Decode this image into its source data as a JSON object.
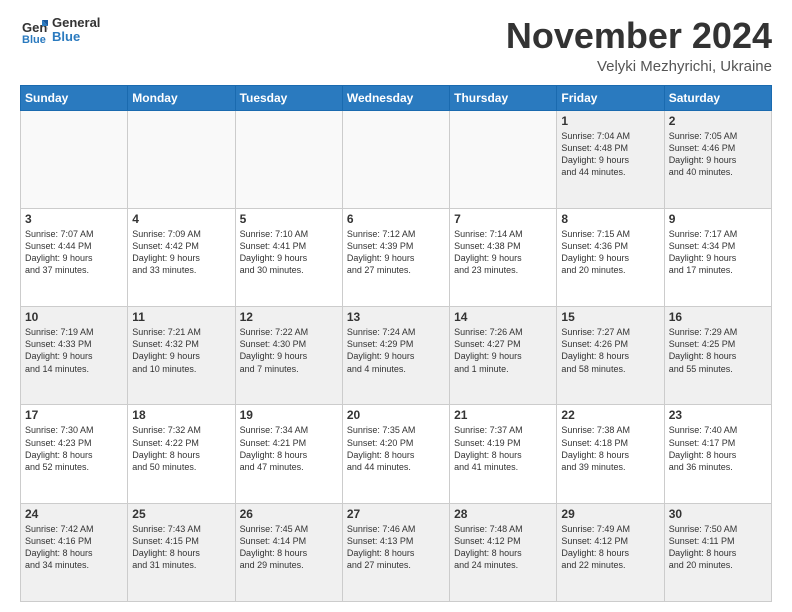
{
  "logo": {
    "line1": "General",
    "line2": "Blue"
  },
  "title": "November 2024",
  "location": "Velyki Mezhyrichi, Ukraine",
  "weekdays": [
    "Sunday",
    "Monday",
    "Tuesday",
    "Wednesday",
    "Thursday",
    "Friday",
    "Saturday"
  ],
  "weeks": [
    [
      {
        "day": "",
        "info": ""
      },
      {
        "day": "",
        "info": ""
      },
      {
        "day": "",
        "info": ""
      },
      {
        "day": "",
        "info": ""
      },
      {
        "day": "",
        "info": ""
      },
      {
        "day": "1",
        "info": "Sunrise: 7:04 AM\nSunset: 4:48 PM\nDaylight: 9 hours\nand 44 minutes."
      },
      {
        "day": "2",
        "info": "Sunrise: 7:05 AM\nSunset: 4:46 PM\nDaylight: 9 hours\nand 40 minutes."
      }
    ],
    [
      {
        "day": "3",
        "info": "Sunrise: 7:07 AM\nSunset: 4:44 PM\nDaylight: 9 hours\nand 37 minutes."
      },
      {
        "day": "4",
        "info": "Sunrise: 7:09 AM\nSunset: 4:42 PM\nDaylight: 9 hours\nand 33 minutes."
      },
      {
        "day": "5",
        "info": "Sunrise: 7:10 AM\nSunset: 4:41 PM\nDaylight: 9 hours\nand 30 minutes."
      },
      {
        "day": "6",
        "info": "Sunrise: 7:12 AM\nSunset: 4:39 PM\nDaylight: 9 hours\nand 27 minutes."
      },
      {
        "day": "7",
        "info": "Sunrise: 7:14 AM\nSunset: 4:38 PM\nDaylight: 9 hours\nand 23 minutes."
      },
      {
        "day": "8",
        "info": "Sunrise: 7:15 AM\nSunset: 4:36 PM\nDaylight: 9 hours\nand 20 minutes."
      },
      {
        "day": "9",
        "info": "Sunrise: 7:17 AM\nSunset: 4:34 PM\nDaylight: 9 hours\nand 17 minutes."
      }
    ],
    [
      {
        "day": "10",
        "info": "Sunrise: 7:19 AM\nSunset: 4:33 PM\nDaylight: 9 hours\nand 14 minutes."
      },
      {
        "day": "11",
        "info": "Sunrise: 7:21 AM\nSunset: 4:32 PM\nDaylight: 9 hours\nand 10 minutes."
      },
      {
        "day": "12",
        "info": "Sunrise: 7:22 AM\nSunset: 4:30 PM\nDaylight: 9 hours\nand 7 minutes."
      },
      {
        "day": "13",
        "info": "Sunrise: 7:24 AM\nSunset: 4:29 PM\nDaylight: 9 hours\nand 4 minutes."
      },
      {
        "day": "14",
        "info": "Sunrise: 7:26 AM\nSunset: 4:27 PM\nDaylight: 9 hours\nand 1 minute."
      },
      {
        "day": "15",
        "info": "Sunrise: 7:27 AM\nSunset: 4:26 PM\nDaylight: 8 hours\nand 58 minutes."
      },
      {
        "day": "16",
        "info": "Sunrise: 7:29 AM\nSunset: 4:25 PM\nDaylight: 8 hours\nand 55 minutes."
      }
    ],
    [
      {
        "day": "17",
        "info": "Sunrise: 7:30 AM\nSunset: 4:23 PM\nDaylight: 8 hours\nand 52 minutes."
      },
      {
        "day": "18",
        "info": "Sunrise: 7:32 AM\nSunset: 4:22 PM\nDaylight: 8 hours\nand 50 minutes."
      },
      {
        "day": "19",
        "info": "Sunrise: 7:34 AM\nSunset: 4:21 PM\nDaylight: 8 hours\nand 47 minutes."
      },
      {
        "day": "20",
        "info": "Sunrise: 7:35 AM\nSunset: 4:20 PM\nDaylight: 8 hours\nand 44 minutes."
      },
      {
        "day": "21",
        "info": "Sunrise: 7:37 AM\nSunset: 4:19 PM\nDaylight: 8 hours\nand 41 minutes."
      },
      {
        "day": "22",
        "info": "Sunrise: 7:38 AM\nSunset: 4:18 PM\nDaylight: 8 hours\nand 39 minutes."
      },
      {
        "day": "23",
        "info": "Sunrise: 7:40 AM\nSunset: 4:17 PM\nDaylight: 8 hours\nand 36 minutes."
      }
    ],
    [
      {
        "day": "24",
        "info": "Sunrise: 7:42 AM\nSunset: 4:16 PM\nDaylight: 8 hours\nand 34 minutes."
      },
      {
        "day": "25",
        "info": "Sunrise: 7:43 AM\nSunset: 4:15 PM\nDaylight: 8 hours\nand 31 minutes."
      },
      {
        "day": "26",
        "info": "Sunrise: 7:45 AM\nSunset: 4:14 PM\nDaylight: 8 hours\nand 29 minutes."
      },
      {
        "day": "27",
        "info": "Sunrise: 7:46 AM\nSunset: 4:13 PM\nDaylight: 8 hours\nand 27 minutes."
      },
      {
        "day": "28",
        "info": "Sunrise: 7:48 AM\nSunset: 4:12 PM\nDaylight: 8 hours\nand 24 minutes."
      },
      {
        "day": "29",
        "info": "Sunrise: 7:49 AM\nSunset: 4:12 PM\nDaylight: 8 hours\nand 22 minutes."
      },
      {
        "day": "30",
        "info": "Sunrise: 7:50 AM\nSunset: 4:11 PM\nDaylight: 8 hours\nand 20 minutes."
      }
    ]
  ]
}
